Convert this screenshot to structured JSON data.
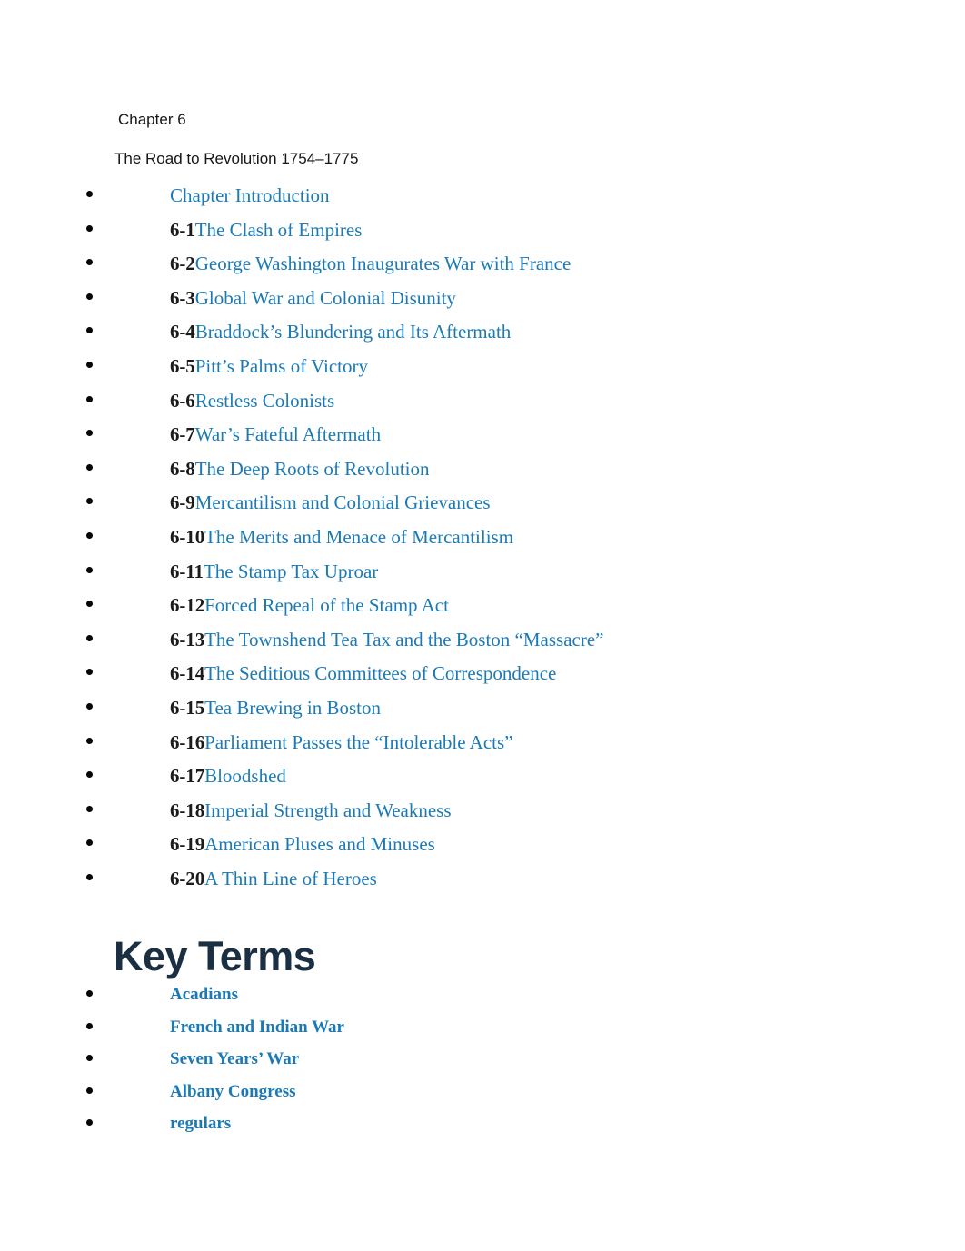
{
  "document": {
    "chapter_label": "Chapter 6",
    "chapter_subtitle": "The Road to Revolution 1754–1775"
  },
  "colors": {
    "link_blue": "#1b7ab5",
    "heading_navy": "#1a3042",
    "section_number_black": "#1b1b1b",
    "body_black": "#161616",
    "bullet_black": "#050505",
    "page_background": "#ffffff"
  },
  "toc": {
    "items": [
      {
        "number": "",
        "title": "Chapter Introduction"
      },
      {
        "number": "6-1",
        "title": "The Clash of Empires"
      },
      {
        "number": "6-2",
        "title": "George Washington Inaugurates War with France"
      },
      {
        "number": "6-3",
        "title": "Global War and Colonial Disunity"
      },
      {
        "number": "6-4",
        "title": "Braddock’s Blundering and Its Aftermath"
      },
      {
        "number": "6-5",
        "title": "Pitt’s Palms of Victory"
      },
      {
        "number": "6-6",
        "title": "Restless Colonists"
      },
      {
        "number": "6-7",
        "title": "War’s Fateful Aftermath"
      },
      {
        "number": "6-8",
        "title": "The Deep Roots of Revolution"
      },
      {
        "number": "6-9",
        "title": "Mercantilism and Colonial Grievances"
      },
      {
        "number": "6-10",
        "title": "The Merits and Menace of Mercantilism"
      },
      {
        "number": "6-11",
        "title": "The Stamp Tax Uproar"
      },
      {
        "number": "6-12",
        "title": "Forced Repeal of the Stamp Act"
      },
      {
        "number": "6-13",
        "title": "The Townshend Tea Tax and the Boston “Massacre”"
      },
      {
        "number": "6-14",
        "title": "The Seditious Committees of Correspondence"
      },
      {
        "number": "6-15",
        "title": "Tea Brewing in Boston"
      },
      {
        "number": "6-16",
        "title": "Parliament Passes the “Intolerable Acts”"
      },
      {
        "number": "6-17",
        "title": "Bloodshed"
      },
      {
        "number": "6-18",
        "title": "Imperial Strength and Weakness"
      },
      {
        "number": "6-19",
        "title": "American Pluses and Minuses"
      },
      {
        "number": "6-20",
        "title": "A Thin Line of Heroes"
      }
    ]
  },
  "key_terms": {
    "heading": "Key Terms",
    "items": [
      {
        "term": "Acadians"
      },
      {
        "term": "French and Indian War"
      },
      {
        "term": "Seven Years’ War"
      },
      {
        "term": "Albany Congress"
      },
      {
        "term": "regulars"
      }
    ]
  }
}
